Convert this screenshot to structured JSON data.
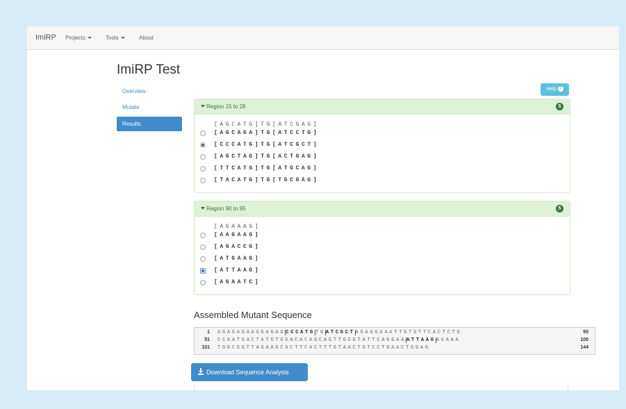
{
  "navbar": {
    "brand": "ImiRP",
    "items": [
      {
        "label": "Projects"
      },
      {
        "label": "Tools"
      },
      {
        "label": "About"
      }
    ]
  },
  "page": {
    "title": "ImiRP Test",
    "help_label": "Help",
    "help_icon": "question-circle-icon"
  },
  "sidebar": {
    "items": [
      {
        "label": "Overview"
      },
      {
        "label": "Mutate"
      },
      {
        "label": "Results"
      }
    ]
  },
  "regions": [
    {
      "title": "Region 15 to 28",
      "badge": "5",
      "original": "[AGCATG]TG[ATCGAG]",
      "options": [
        {
          "seq": "[AGCAGA]TG[ATCCTG]",
          "checked": false
        },
        {
          "seq": "[CCCATG]TG[ATCGCT]",
          "checked": true
        },
        {
          "seq": "[AGCTAG]TG[ACTGAG]",
          "checked": false
        },
        {
          "seq": "[TTCATG]TG[ATGCAG]",
          "checked": false
        },
        {
          "seq": "[TACATG]TG[TGCGAG]",
          "checked": false
        }
      ]
    },
    {
      "title": "Region 90 to 95",
      "badge": "5",
      "original": "[AGAAAG]",
      "options": [
        {
          "seq": "[AAGAAG]",
          "checked": false
        },
        {
          "seq": "[AGACCG]",
          "checked": false
        },
        {
          "seq": "[ATGAAG]",
          "checked": false
        },
        {
          "seq": "[ATTAAG]",
          "checked": true
        },
        {
          "seq": "[AGAATC]",
          "checked": false
        }
      ]
    }
  ],
  "assembled": {
    "title": "Assembled Mutant Sequence",
    "lines": [
      {
        "start": "1",
        "end": "50",
        "segments": [
          "AGAGAGAAGGAGAG",
          "CCCATG",
          "TG",
          "ATCGCT",
          "AGAGGAAATTGTGTTCACTCTG"
        ]
      },
      {
        "start": "51",
        "end": "100",
        "segments": [
          "CCAATGACTATGTGGACACAGCAGTTGGGTATTCAGGAA",
          "ATTAAG",
          "AGAAA"
        ]
      },
      {
        "start": "101",
        "end": "144",
        "segments": [
          "TGGCGGTTAGAAGCACTTCACTTTGTAACTGTCCTGAACTGGAG"
        ]
      }
    ]
  },
  "download": {
    "label": "Download Sequence Analysis",
    "icon": "download-icon"
  },
  "colors": {
    "primary": "#428bca",
    "info": "#5bc0de",
    "success_bg": "#dff0d8",
    "success_text": "#3c763d",
    "page_bg": "#d6edf7"
  }
}
